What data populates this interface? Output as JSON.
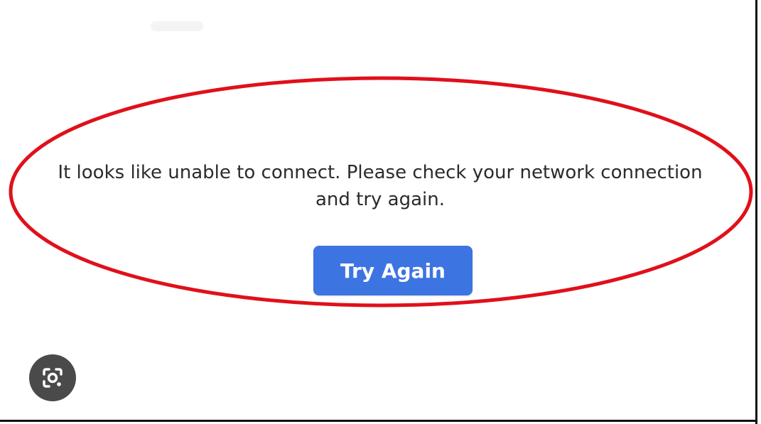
{
  "dialog": {
    "message_line1": "It looks like unable to connect. Please check your network connection",
    "message_line2": "and try again.",
    "retry_label": "Try Again"
  },
  "overlay": {
    "lens_icon": "google-lens-icon"
  },
  "colors": {
    "button_bg": "#3c74e2",
    "highlight_ellipse": "#e0101a",
    "text": "#2b2b2b"
  }
}
